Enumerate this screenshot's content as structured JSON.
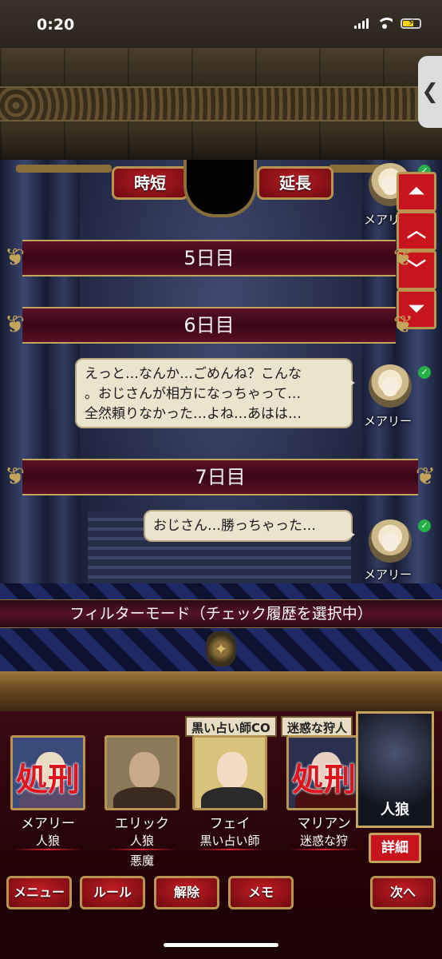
{
  "status_bar": {
    "time": "0:20"
  },
  "side_tab": {
    "icon": "chevron-left-icon",
    "glyph": "❮"
  },
  "controls": {
    "shorten_label": "時短",
    "extend_label": "延長"
  },
  "scroll_buttons": {
    "top_glyph": "⏶",
    "up_glyph": "︿",
    "down_glyph": "﹀",
    "bottom_glyph": "⏷"
  },
  "log": {
    "top_speaker": "メアリ",
    "days": [
      "5日目",
      "6日目",
      "7日目"
    ],
    "messages": [
      {
        "speaker": "メアリー",
        "lines": [
          "えっと…なんか…ごめんね？こんな",
          "。おじさんが相方になっちゃって…",
          "全然頼りなかった…よね…あはは…"
        ]
      },
      {
        "speaker": "メアリー",
        "lines": [
          "おじさん…勝っちゃった…"
        ]
      }
    ]
  },
  "filter": {
    "label": "フィルターモード（チェック履歴を選択中）"
  },
  "players": [
    {
      "name": "メアリー",
      "role": "人狼",
      "role2": "",
      "stamp": "処刑",
      "tag": "",
      "skin": "#e9dcc0",
      "body": "#5a4a6a",
      "bg": "#3a4a7a"
    },
    {
      "name": "エリック",
      "role": "人狼",
      "role2": "悪魔",
      "stamp": "",
      "tag": "",
      "skin": "#c9a98a",
      "body": "#3a2a20",
      "bg": "#8a7a5a"
    },
    {
      "name": "フェイ",
      "role": "黒い占い師",
      "role2": "",
      "stamp": "",
      "tag": "黒い占い師CO",
      "skin": "#f2dcc4",
      "body": "#2a2a2a",
      "bg": "#d9c27a"
    },
    {
      "name": "マリアン",
      "role": "迷惑な狩",
      "role2": "",
      "stamp": "処刑",
      "tag": "迷惑な狩人",
      "skin": "#e9d0c0",
      "body": "#4a1010",
      "bg": "#2a3050"
    }
  ],
  "selected": {
    "label": "人狼",
    "detail_label": "詳細"
  },
  "bottom_bar": {
    "menu": "メニュー",
    "rules": "ルール",
    "release": "解除",
    "memo": "メモ",
    "next": "次へ"
  },
  "colors": {
    "crimson": "#c8141c",
    "gold": "#b9944f",
    "maroon": "#3a0716"
  }
}
